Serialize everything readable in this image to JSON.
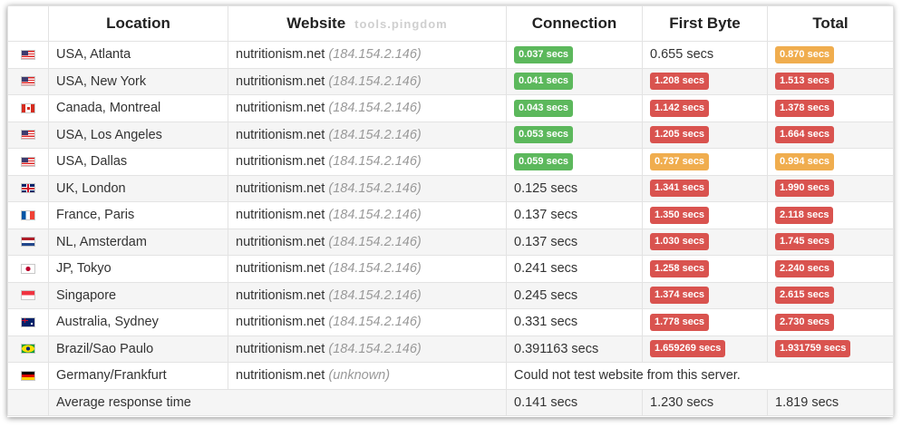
{
  "columns": {
    "location": "Location",
    "website": "Website",
    "connection": "Connection",
    "first_byte": "First Byte",
    "total": "Total"
  },
  "watermark": "tools.pingdom",
  "rows": [
    {
      "flag": "us-flag-icon",
      "location": "USA, Atlanta",
      "site": "nutritionism.net",
      "ip": "(184.154.2.146)",
      "connection": {
        "text": "0.037 secs",
        "level": "green"
      },
      "first_byte": {
        "text": "0.655 secs",
        "level": "plain"
      },
      "total": {
        "text": "0.870 secs",
        "level": "orange"
      }
    },
    {
      "flag": "us-flag-icon",
      "location": "USA, New York",
      "site": "nutritionism.net",
      "ip": "(184.154.2.146)",
      "connection": {
        "text": "0.041 secs",
        "level": "green"
      },
      "first_byte": {
        "text": "1.208 secs",
        "level": "red"
      },
      "total": {
        "text": "1.513 secs",
        "level": "red"
      }
    },
    {
      "flag": "ca-flag-icon",
      "location": "Canada, Montreal",
      "site": "nutritionism.net",
      "ip": "(184.154.2.146)",
      "connection": {
        "text": "0.043 secs",
        "level": "green"
      },
      "first_byte": {
        "text": "1.142 secs",
        "level": "red"
      },
      "total": {
        "text": "1.378 secs",
        "level": "red"
      }
    },
    {
      "flag": "us-flag-icon",
      "location": "USA, Los Angeles",
      "site": "nutritionism.net",
      "ip": "(184.154.2.146)",
      "connection": {
        "text": "0.053 secs",
        "level": "green"
      },
      "first_byte": {
        "text": "1.205 secs",
        "level": "red"
      },
      "total": {
        "text": "1.664 secs",
        "level": "red"
      }
    },
    {
      "flag": "us-flag-icon",
      "location": "USA, Dallas",
      "site": "nutritionism.net",
      "ip": "(184.154.2.146)",
      "connection": {
        "text": "0.059 secs",
        "level": "green"
      },
      "first_byte": {
        "text": "0.737 secs",
        "level": "orange"
      },
      "total": {
        "text": "0.994 secs",
        "level": "orange"
      }
    },
    {
      "flag": "uk-flag-icon",
      "location": "UK, London",
      "site": "nutritionism.net",
      "ip": "(184.154.2.146)",
      "connection": {
        "text": "0.125 secs",
        "level": "plain"
      },
      "first_byte": {
        "text": "1.341 secs",
        "level": "red"
      },
      "total": {
        "text": "1.990 secs",
        "level": "red"
      }
    },
    {
      "flag": "fr-flag-icon",
      "location": "France, Paris",
      "site": "nutritionism.net",
      "ip": "(184.154.2.146)",
      "connection": {
        "text": "0.137 secs",
        "level": "plain"
      },
      "first_byte": {
        "text": "1.350 secs",
        "level": "red"
      },
      "total": {
        "text": "2.118 secs",
        "level": "red"
      }
    },
    {
      "flag": "nl-flag-icon",
      "location": "NL, Amsterdam",
      "site": "nutritionism.net",
      "ip": "(184.154.2.146)",
      "connection": {
        "text": "0.137 secs",
        "level": "plain"
      },
      "first_byte": {
        "text": "1.030 secs",
        "level": "red"
      },
      "total": {
        "text": "1.745 secs",
        "level": "red"
      }
    },
    {
      "flag": "jp-flag-icon",
      "location": "JP, Tokyo",
      "site": "nutritionism.net",
      "ip": "(184.154.2.146)",
      "connection": {
        "text": "0.241 secs",
        "level": "plain"
      },
      "first_byte": {
        "text": "1.258 secs",
        "level": "red"
      },
      "total": {
        "text": "2.240 secs",
        "level": "red"
      }
    },
    {
      "flag": "sg-flag-icon",
      "location": "Singapore",
      "site": "nutritionism.net",
      "ip": "(184.154.2.146)",
      "connection": {
        "text": "0.245 secs",
        "level": "plain"
      },
      "first_byte": {
        "text": "1.374 secs",
        "level": "red"
      },
      "total": {
        "text": "2.615 secs",
        "level": "red"
      }
    },
    {
      "flag": "au-flag-icon",
      "location": "Australia, Sydney",
      "site": "nutritionism.net",
      "ip": "(184.154.2.146)",
      "connection": {
        "text": "0.331 secs",
        "level": "plain"
      },
      "first_byte": {
        "text": "1.778 secs",
        "level": "red"
      },
      "total": {
        "text": "2.730 secs",
        "level": "red"
      }
    },
    {
      "flag": "br-flag-icon",
      "location": "Brazil/Sao Paulo",
      "site": "nutritionism.net",
      "ip": "(184.154.2.146)",
      "connection": {
        "text": "0.391163 secs",
        "level": "plain"
      },
      "first_byte": {
        "text": "1.659269 secs",
        "level": "red"
      },
      "total": {
        "text": "1.931759 secs",
        "level": "red"
      }
    }
  ],
  "error_row": {
    "flag": "de-flag-icon",
    "location": "Germany/Frankfurt",
    "site": "nutritionism.net",
    "ip": "(unknown)",
    "message": "Could not test website from this server."
  },
  "average_row": {
    "label": "Average response time",
    "connection": "0.141 secs",
    "first_byte": "1.230 secs",
    "total": "1.819 secs"
  },
  "colors": {
    "green": "#5cb85c",
    "red": "#d9534f",
    "orange": "#f0ad4e"
  }
}
